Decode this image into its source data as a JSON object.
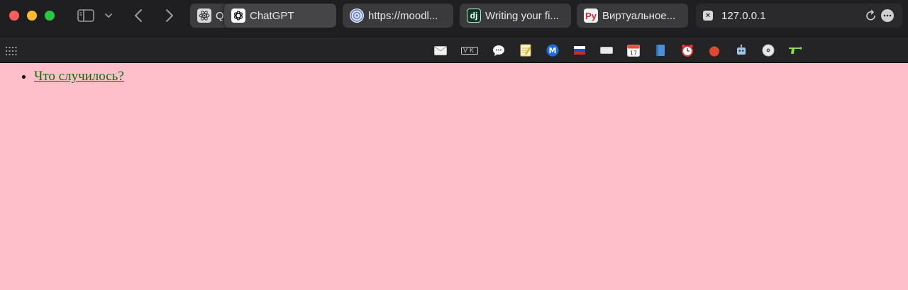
{
  "browser": {
    "tabs": [
      {
        "label": "Q",
        "icon": "atom-icon"
      },
      {
        "label": "ChatGPT",
        "icon": "openai-icon"
      },
      {
        "label": "https://moodl...",
        "icon": "moodle-icon"
      },
      {
        "label": "Writing your fi...",
        "icon": "django-icon",
        "favicon_text": "dj"
      },
      {
        "label": "Виртуальное...",
        "icon": "ru-logo-icon",
        "favicon_text": "Py"
      }
    ],
    "address_bar": {
      "url": "127.0.0.1"
    },
    "bookmarks": [
      "mail-icon",
      "vk-icon",
      "chat-bubble-icon",
      "notes-icon",
      "m-logo-icon",
      "russia-flag-icon",
      "keyboard-icon",
      "calendar-icon",
      "book-icon",
      "alarm-clock-icon",
      "tomato-icon",
      "robot-icon",
      "disc-icon",
      "water-gun-icon"
    ],
    "bookmark_texts": {
      "vk": "VK",
      "calendar_day": "17"
    }
  },
  "colors": {
    "page_background": "#ffbfca",
    "link": "#0b6f0b",
    "chrome": "#1f1f21"
  },
  "page": {
    "list": [
      {
        "text": "Что случилось?"
      }
    ]
  }
}
